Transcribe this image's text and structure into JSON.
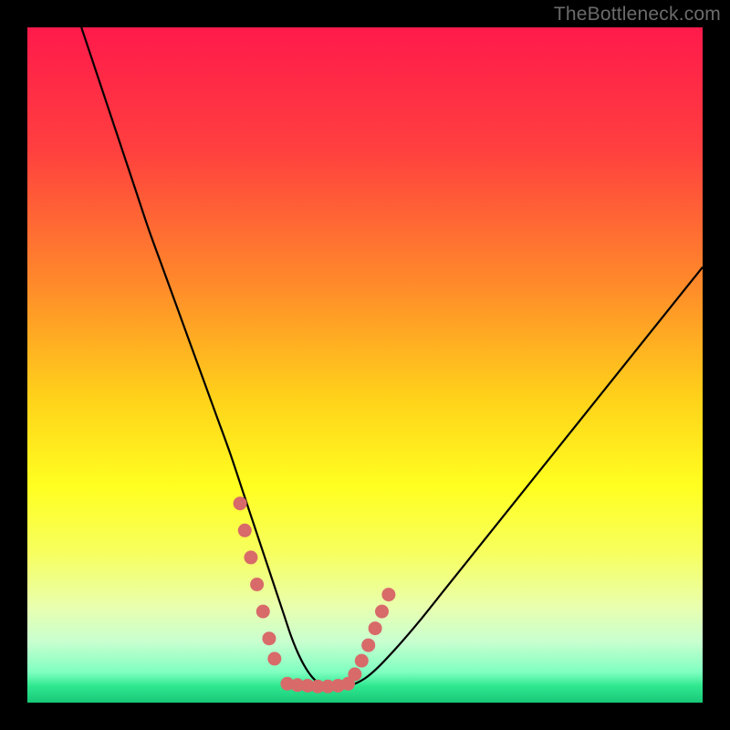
{
  "watermark": "TheBottleneck.com",
  "chart_data": {
    "type": "line",
    "title": "",
    "xlabel": "",
    "ylabel": "",
    "xlim": [
      0,
      100
    ],
    "ylim": [
      0,
      100
    ],
    "grid": false,
    "legend": false,
    "gradient_stops": [
      {
        "pos": 0.0,
        "color": "#ff1a4b"
      },
      {
        "pos": 0.18,
        "color": "#ff3f3f"
      },
      {
        "pos": 0.38,
        "color": "#ff8a2a"
      },
      {
        "pos": 0.55,
        "color": "#ffd21a"
      },
      {
        "pos": 0.68,
        "color": "#ffff20"
      },
      {
        "pos": 0.78,
        "color": "#f7ff60"
      },
      {
        "pos": 0.86,
        "color": "#e8ffb0"
      },
      {
        "pos": 0.91,
        "color": "#c8ffd0"
      },
      {
        "pos": 0.955,
        "color": "#7fffc0"
      },
      {
        "pos": 0.975,
        "color": "#30e890"
      },
      {
        "pos": 1.0,
        "color": "#18c878"
      }
    ],
    "series": [
      {
        "name": "bottleneck-curve",
        "color": "#000000",
        "x": [
          8,
          10,
          12,
          14,
          16,
          18,
          20,
          22,
          24,
          26,
          28,
          30,
          32,
          33,
          34,
          35,
          36,
          37,
          38,
          39,
          40,
          41,
          42,
          43,
          44,
          45,
          46,
          48,
          50,
          52,
          55,
          58,
          62,
          66,
          70,
          74,
          78,
          82,
          86,
          90,
          94,
          98,
          100
        ],
        "y": [
          100,
          94,
          88,
          82,
          76,
          70,
          64.5,
          59,
          53.5,
          48,
          42.5,
          37,
          31,
          28,
          25,
          22,
          19,
          16,
          13,
          10,
          7.5,
          5.5,
          4,
          3,
          2.5,
          2.2,
          2.2,
          2.6,
          3.6,
          5.3,
          8.5,
          12,
          17,
          22,
          27,
          32,
          37,
          42,
          47,
          52,
          57,
          62,
          64.5
        ]
      }
    ],
    "highlight_segments": [
      {
        "name": "left-flank",
        "color": "#d86a6a",
        "x": [
          31.5,
          32.2,
          33.1,
          34.0,
          34.9,
          35.8,
          36.6
        ],
        "y": [
          29.5,
          25.5,
          21.5,
          17.5,
          13.5,
          9.5,
          6.5
        ]
      },
      {
        "name": "valley-floor",
        "color": "#d86a6a",
        "x": [
          38.5,
          40.0,
          41.5,
          43.0,
          44.5,
          46.0,
          47.5
        ],
        "y": [
          2.8,
          2.6,
          2.5,
          2.4,
          2.4,
          2.5,
          2.8
        ]
      },
      {
        "name": "right-flank",
        "color": "#d86a6a",
        "x": [
          48.5,
          49.5,
          50.5,
          51.5,
          52.5,
          53.5
        ],
        "y": [
          4.2,
          6.2,
          8.5,
          11.0,
          13.5,
          16.0
        ]
      }
    ]
  }
}
